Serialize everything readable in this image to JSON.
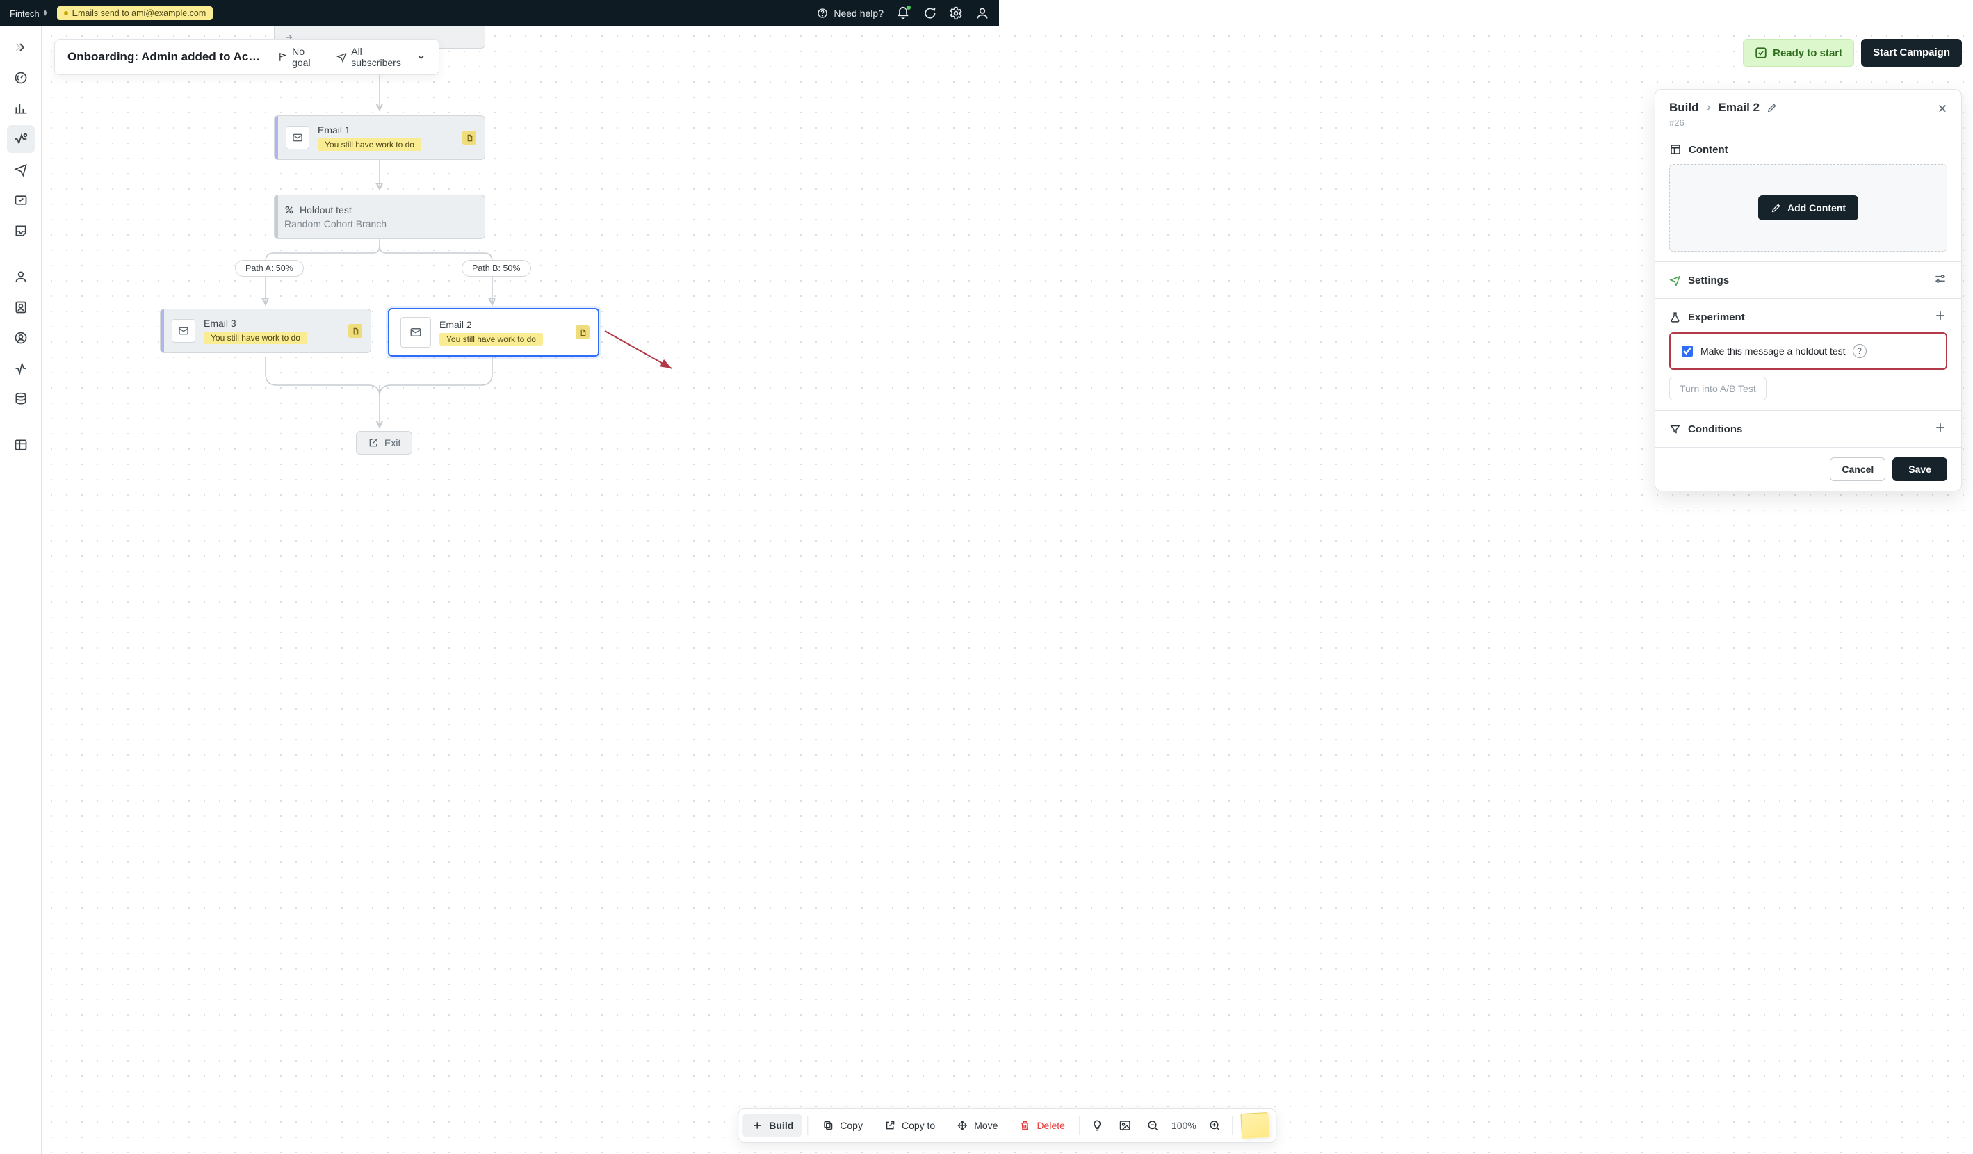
{
  "topbar": {
    "workspace": "Fintech",
    "context_tag": "Emails send to ami@example.com",
    "help_label": "Need help?"
  },
  "header": {
    "title": "Onboarding: Admin added to Acco…",
    "goal_label": "No goal",
    "audience_label": "All subscribers"
  },
  "top_actions": {
    "ready": "Ready to start",
    "start": "Start Campaign"
  },
  "flow": {
    "email1": {
      "title": "Email 1",
      "pill": "You still have work to do"
    },
    "holdout": {
      "title": "Holdout test",
      "subtitle": "Random Cohort Branch"
    },
    "path_a": "Path A: 50%",
    "path_b": "Path B: 50%",
    "email3": {
      "title": "Email 3",
      "pill": "You still have work to do"
    },
    "email2": {
      "title": "Email 2",
      "pill": "You still have work to do"
    },
    "exit": "Exit"
  },
  "panel": {
    "crumb_root": "Build",
    "crumb_leaf": "Email 2",
    "id": "#26",
    "content": {
      "heading": "Content",
      "add_btn": "Add Content"
    },
    "settings": {
      "heading": "Settings"
    },
    "experiment": {
      "heading": "Experiment",
      "holdout_label": "Make this message a holdout test",
      "ab_label": "Turn into A/B Test"
    },
    "conditions": {
      "heading": "Conditions"
    },
    "cancel": "Cancel",
    "save": "Save"
  },
  "toolbar": {
    "build": "Build",
    "copy": "Copy",
    "copy_to": "Copy to",
    "move": "Move",
    "delete": "Delete",
    "zoom": "100%"
  }
}
